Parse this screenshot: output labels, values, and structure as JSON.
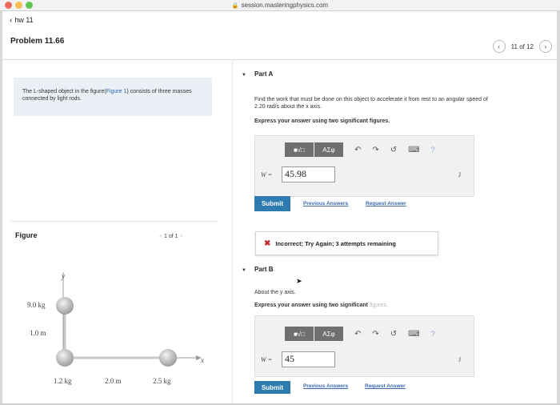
{
  "browser": {
    "url": "session.masteringphysics.com",
    "traffic": {
      "red": "#ed6a5e",
      "yellow": "#f5bf4f",
      "green": "#61c454"
    }
  },
  "breadcrumb": {
    "back_icon": "chevron-left-icon",
    "label": "hw 11"
  },
  "problem": {
    "title": "Problem 11.66",
    "pager": "11 of 12"
  },
  "description": {
    "before": "The L-shaped object in the figure(",
    "link": "Figure 1",
    "after": ") consists of three masses connected by light rods."
  },
  "figure": {
    "label": "Figure",
    "pager": "1 of 1",
    "y_axis": "y",
    "x_axis": "x",
    "mass_top": "9.0 kg",
    "dist_vertical": "1.0 m",
    "mass_corner": "1.2 kg",
    "dist_horizontal": "2.0 m",
    "mass_right": "2.5 kg"
  },
  "part_a": {
    "title": "Part A",
    "question_1": "Find the work that must be done on this object to accelerate it from rest to an angular speed of",
    "question_2": "2.20 rad/s about the x axis.",
    "instruction": "Express your answer using two significant figures.",
    "toolbar": {
      "templates": "■√□",
      "symbols": "ΑΣφ",
      "undo": "↶",
      "redo": "↷",
      "reset": "↺",
      "keyboard": "⌨",
      "help": "?"
    },
    "answer_label": "W =",
    "answer_value": "45.98",
    "unit": "J",
    "submit": "Submit",
    "previous_answers": "Previous Answers",
    "request_answer": "Request Answer",
    "feedback_icon": "✖",
    "feedback": "Incorrect; Try Again; 3 attempts remaining"
  },
  "part_b": {
    "title": "Part B",
    "question": "About the y axis.",
    "instruction_main": "Express your answer using two significant ",
    "instruction_faint": "figures.",
    "toolbar": {
      "templates": "■√□",
      "symbols": "ΑΣφ",
      "undo": "↶",
      "redo": "↷",
      "reset": "↺",
      "keyboard": "⌨",
      "help": "?"
    },
    "answer_label": "W =",
    "answer_value": "45",
    "unit": "J",
    "submit": "Submit",
    "previous_answers": "Previous Answers",
    "request_answer": "Request Answer"
  }
}
